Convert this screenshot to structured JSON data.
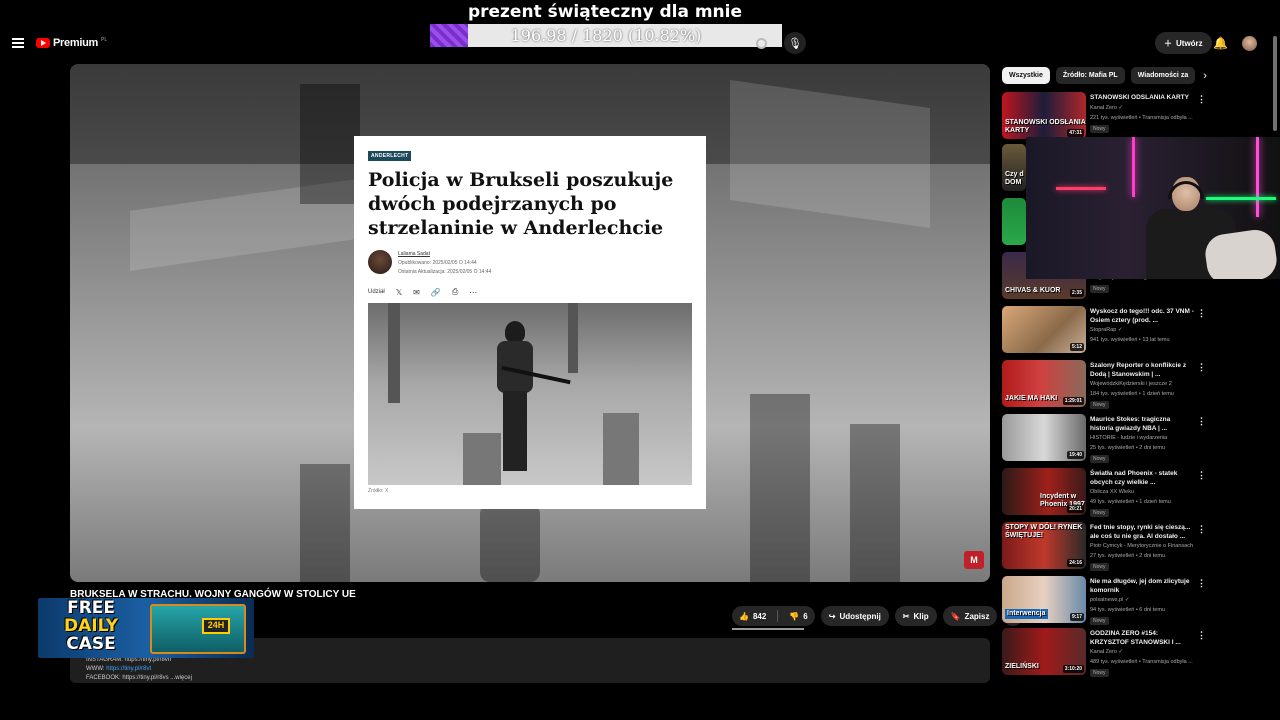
{
  "overlay": {
    "goal_title": "prezent świąteczny dla mnie",
    "goal_text": "196.98 / 1820 (10.82%)",
    "goal_progress": 0.1082
  },
  "topbar": {
    "logo_text": "Premium",
    "logo_region": "PL",
    "create_label": "Utwórz"
  },
  "article": {
    "tag": "ANDERLECHT",
    "headline": "Policja w Brukseli poszukuje dwóch podejrzanych po strzelaninie w Anderlechcie",
    "author": "Laliama Sadat",
    "published": "Opublikowano: 2025/02/05 O 14:44",
    "updated": "Ostatnia Aktualizacja: 2025/02/05 O 14:44",
    "share_label": "Udział",
    "photo_credit": "Źródło: X"
  },
  "player": {
    "channel_badge": "M"
  },
  "video": {
    "title": "BRUKSELA W STRACHU. WOJNY GANGÓW W STOLICY UE",
    "likes": "842",
    "dislikes": "6",
    "share_label": "Udostępnij",
    "clip_label": "Klip",
    "save_label": "Zapisz",
    "desc_line1": "INSTAGRAM: https://tiny.pl/r8vn",
    "desc_line2_prefix": "WWW: ",
    "desc_line2_link": "https://tiny.pl/r8vt",
    "desc_line3": "FACEBOOK: https://tiny.pl/r8vs ...więcej"
  },
  "promo": {
    "line1": "FREE",
    "line2": "DAILY",
    "line3": "CASE",
    "box_tag": "24H"
  },
  "chips": [
    "Wszystkie",
    "Źródło: Mafia PL",
    "Wiadomości za"
  ],
  "recs": [
    {
      "title": "STANOWSKI ODSLANIA KARTY",
      "channel": "Kanał Zero ✓",
      "meta": "221 tys. wyświetleń • Transmisja odbyła ...",
      "new": "Nowy",
      "duration": "47:31",
      "caption": "STANOWSKI ODSŁANIA KARTY"
    },
    {
      "title": "",
      "channel": "",
      "meta": "",
      "new": "",
      "duration": "",
      "caption": "Czy d DOM"
    },
    {
      "title": "",
      "channel": "",
      "meta": "",
      "new": "",
      "duration": "",
      "caption": ""
    },
    {
      "title": "",
      "channel": "",
      "meta": "61 tys. wyświetleń • 8 godzin temu",
      "new": "Nowy",
      "duration": "2:35",
      "caption": "CHIVAS & KUOR"
    },
    {
      "title": "Wyskocz do tego!!! odc. 37 VNM - Osiem cztery (prod. ...",
      "channel": "StopraRap ✓",
      "meta": "941 tys. wyświetleń • 13 lat temu",
      "new": "",
      "duration": "5:12",
      "caption": ""
    },
    {
      "title": "Szalony Reporter o konflikcie z Dodą | Stanowskim | ...",
      "channel": "WojewódzkiKędzierski i jeszcze 2",
      "meta": "184 tys. wyświetleń • 1 dzień temu",
      "new": "Nowy",
      "duration": "1:29:01",
      "caption": "JAKIE MA HAKI"
    },
    {
      "title": "Maurice Stokes: tragiczna historia gwiazdy NBA | ...",
      "channel": "HISTORIE - ludzie i wydarzenia",
      "meta": "25 tys. wyświetleń • 2 dni temu",
      "new": "Nowy",
      "duration": "19:40",
      "caption": ""
    },
    {
      "title": "Światła nad Phoenix - statek obcych czy wielkie ...",
      "channel": "Oblicza XX Wieku",
      "meta": "49 tys. wyświetleń • 1 dzień temu",
      "new": "Nowy",
      "duration": "20:21",
      "caption": "Incydent w Phoenix 1997"
    },
    {
      "title": "Fed tnie stopy, rynki się cieszą... ale coś tu nie gra. AI dostało ...",
      "channel": "Piotr Cymcyk - Merytorycznie o Finansach",
      "meta": "27 tys. wyświetleń • 2 dni temu",
      "new": "Nowy",
      "duration": "24:16",
      "caption": "STOPY W DÓŁ! RYNEK ŚWIĘTUJE!"
    },
    {
      "title": "Nie ma długów, jej dom zlicytuje komornik",
      "channel": "polsatnews.pl ✓",
      "meta": "94 tys. wyświetleń • 6 dni temu",
      "new": "Nowy",
      "duration": "9:17",
      "caption": "Interwencja"
    },
    {
      "title": "GODZINA ZERO #154: KRZYSZTOF STANOWSKI I ...",
      "channel": "Kanał Zero ✓",
      "meta": "489 tys. wyświetleń • Transmisja odbyła ...",
      "new": "Nowy",
      "duration": "3:10:20",
      "caption": "ZIELIŃSKI"
    }
  ]
}
